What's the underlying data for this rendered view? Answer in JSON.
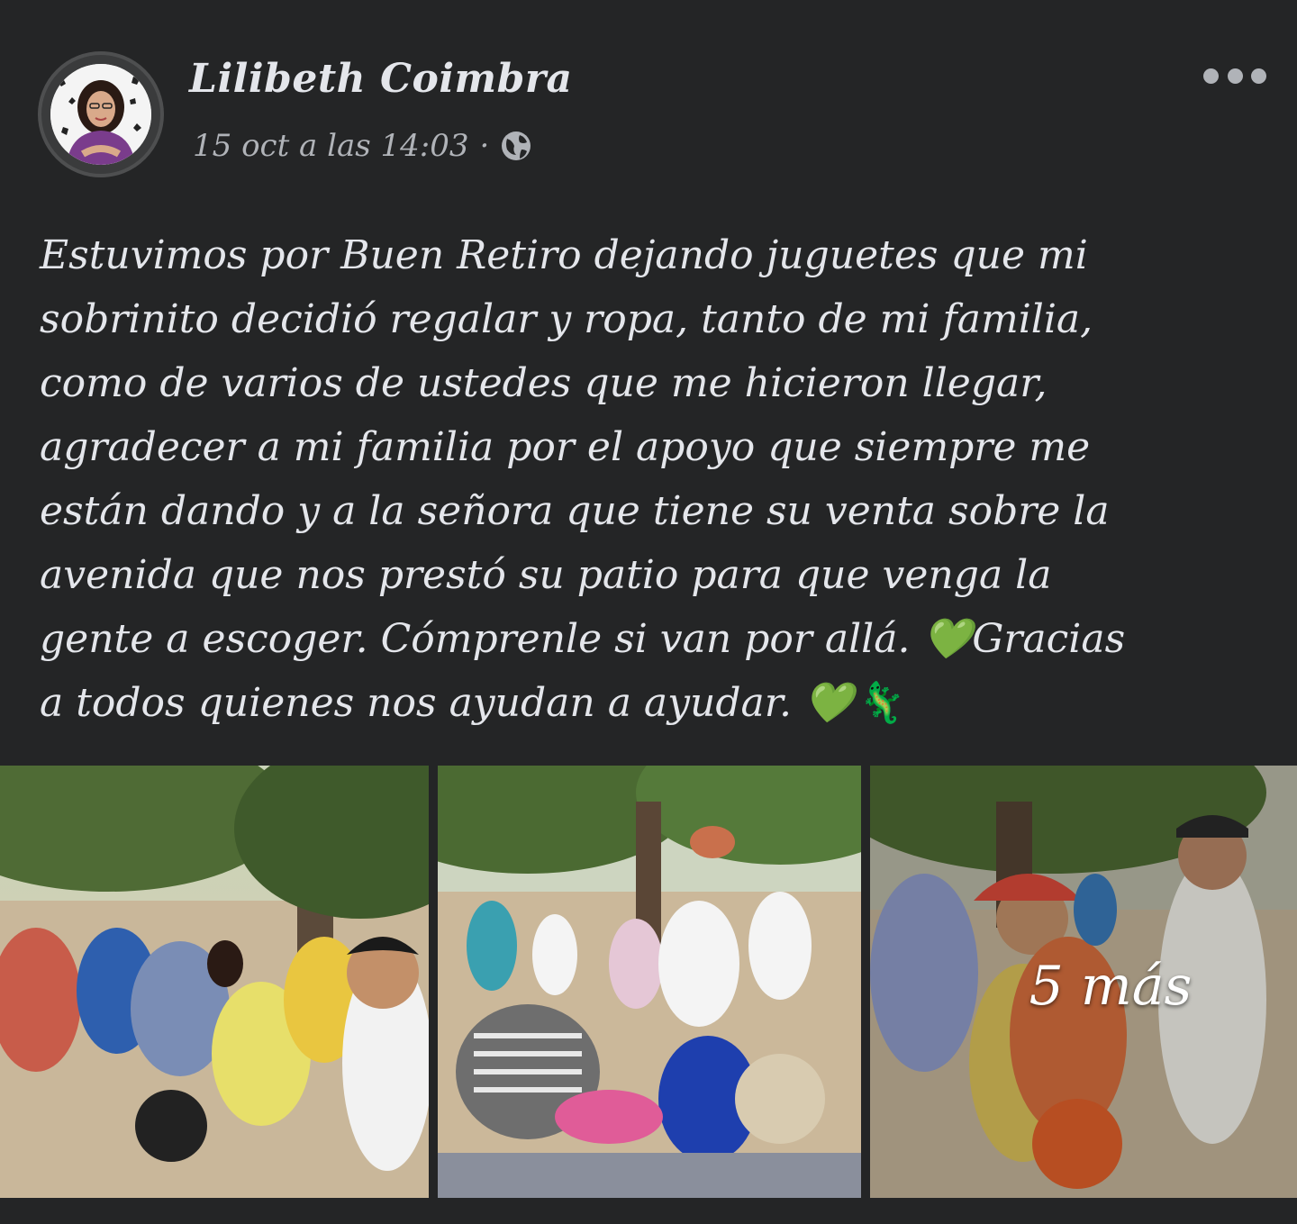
{
  "post": {
    "author": "Lilibeth Coimbra",
    "timestamp": "15 oct a las 14:03",
    "separator": "·",
    "audience_icon": "globe-icon",
    "menu_icon": "more-options-icon",
    "text_lines": [
      "Estuvimos por Buen Retiro dejando juguetes que mi",
      "sobrinito decidió regalar y ropa, tanto de mi familia,",
      "como de varios de ustedes que me hicieron llegar,",
      "agradecer a mi familia por el apoyo que siempre me",
      "están dando y a la señora que tiene su venta sobre la",
      "avenida que nos prestó su patio para que venga la",
      "gente a escoger. Cómprenle si van por allá. 💚Gracias",
      "a todos quienes nos ayudan a ayudar. 💚🦎"
    ],
    "photos": [
      {
        "name": "photo-1",
        "icon": "photo-thumbnail"
      },
      {
        "name": "photo-2",
        "icon": "photo-thumbnail"
      },
      {
        "name": "photo-3",
        "icon": "photo-thumbnail"
      }
    ],
    "more_photos_label": "5 más"
  },
  "colors": {
    "background": "#242526",
    "primary_text": "#e4e6eb",
    "secondary_text": "#b0b3b8"
  }
}
